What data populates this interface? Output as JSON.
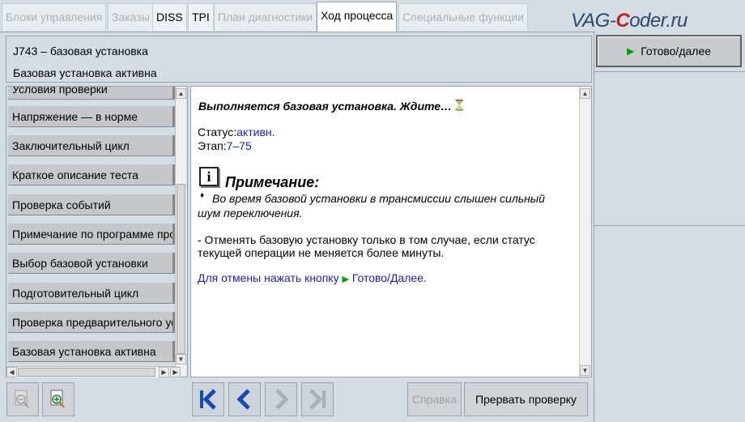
{
  "tabs": [
    {
      "label": "Блоки управления",
      "state": "disabled"
    },
    {
      "label": "Заказы",
      "state": "disabled"
    },
    {
      "label": "DISS",
      "state": "enabled"
    },
    {
      "label": "TPI",
      "state": "enabled"
    },
    {
      "label": "План диагностики",
      "state": "disabled"
    },
    {
      "label": "Ход процесса",
      "state": "active"
    },
    {
      "label": "Специальные функции",
      "state": "disabled"
    }
  ],
  "logo": {
    "part1": "VAG-",
    "part2": "C",
    "part3": "oder.ru"
  },
  "header": {
    "line1": "J743 – базовая установка",
    "line2": "Базовая установка активна"
  },
  "steps": [
    "Условия проверки",
    "Напряжение — в норме",
    "Заключительный цикл",
    "Краткое описание теста",
    "Проверка событий",
    "Примечание по программе проверки",
    "Выбор базовой установки",
    "Подготовительный цикл",
    "Проверка предварительного условия",
    "Базовая установка активна"
  ],
  "content": {
    "title": "Выполняется базовая установка. Ждите…",
    "status_label": "Статус:",
    "status_value": "активн.",
    "stage_label": "Этап:",
    "stage_value": "7–75",
    "note_icon": "i",
    "note_title": "Примечание:",
    "note_line1": "Во время базовой установки в трансмиссии слышен сильный",
    "note_line2": "шум переключения.",
    "para_line1": "- Отменять базовую установку только в том случае, если статус",
    "para_line2": "текущей операции не меняется более минуты.",
    "cancel_text": "Для отмены нажать кнопку",
    "cancel_btn_ref": "Готово/Далее."
  },
  "buttons": {
    "ready": "Готово/далее",
    "help": "Справка",
    "abort": "Прервать проверку"
  },
  "colors": {
    "accent_blue": "#2020c0",
    "green_triangle": "#00a000",
    "nav_blue": "#1848b8"
  }
}
